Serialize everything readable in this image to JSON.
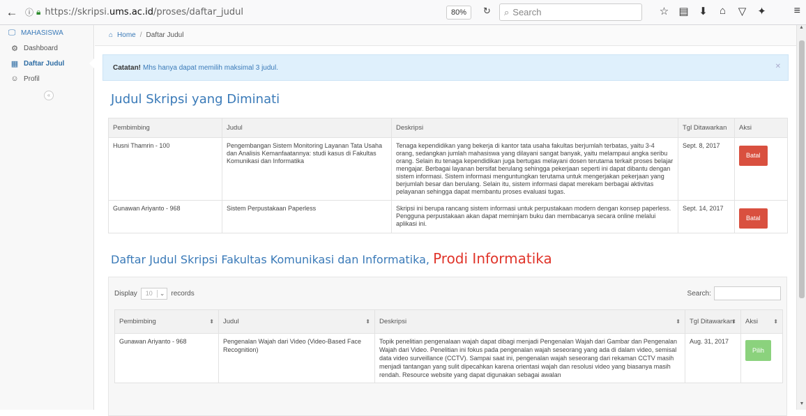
{
  "browser": {
    "url_prefix": "https://skripsi.",
    "url_domain": "ums.ac.id",
    "url_path": "/proses/daftar_judul",
    "zoom": "80%",
    "search_placeholder": "Search"
  },
  "sidebar": {
    "header": "MAHASISWA",
    "items": [
      {
        "label": "Dashboard"
      },
      {
        "label": "Daftar Judul"
      },
      {
        "label": "Profil"
      }
    ]
  },
  "breadcrumb": {
    "home": "Home",
    "sep": "/",
    "current": "Daftar Judul"
  },
  "alert": {
    "bold": "Catatan!",
    "text": "Mhs hanya dapat memilih maksimal 3 judul."
  },
  "section1": {
    "title": "Judul Skripsi yang Diminati",
    "headers": [
      "Pembimbing",
      "Judul",
      "Deskripsi",
      "Tgl Ditawarkan",
      "Aksi"
    ],
    "rows": [
      {
        "pembimbing": "Husni Thamrin - 100",
        "judul": "Pengembangan Sistem Monitoring Layanan Tata Usaha dan Analisis Kemanfaatannya: studi kasus di Fakultas Komunikasi dan Informatika",
        "deskripsi": "Tenaga kependidikan yang bekerja di kantor tata usaha fakultas berjumlah terbatas, yaitu 3-4 orang, sedangkan jumlah mahasiswa yang dilayani sangat banyak, yaitu melampaui angka seribu orang. Selain itu tenaga kependidikan juga bertugas melayani dosen terutama terkait proses belajar mengajar. Berbagai layanan bersifat berulang sehingga pekerjaan seperti ini dapat dibantu dengan sistem informasi. Sistem informasi menguntungkan terutama untuk mengerjakan pekerjaan yang berjumlah besar dan berulang. Selain itu, sistem informasi dapat merekam berbagai aktivitas pelayanan sehingga dapat membantu proses evaluasi tugas.",
        "tgl": "Sept. 8, 2017",
        "aksi": "Batal"
      },
      {
        "pembimbing": "Gunawan Ariyanto - 968",
        "judul": "Sistem Perpustakaan Paperless",
        "deskripsi": "Skripsi ini berupa rancang sistem informasi untuk perpustakaan modern dengan konsep paperless. Pengguna perpustakaan akan dapat meminjam buku dan membacanya secara online melalui aplikasi ini.",
        "tgl": "Sept. 14, 2017",
        "aksi": "Batal"
      }
    ]
  },
  "section2": {
    "title": "Daftar Judul Skripsi Fakultas Komunikasi dan Informatika,",
    "prodi": "Prodi Informatika",
    "display_label": "Display",
    "display_value": "10",
    "records_label": "records",
    "search_label": "Search:",
    "headers": [
      "Pembimbing",
      "Judul",
      "Deskripsi",
      "Tgl Ditawarkan",
      "Aksi"
    ],
    "rows": [
      {
        "pembimbing": "Gunawan Ariyanto - 968",
        "judul": "Pengenalan Wajah dari Video (Video-Based Face Recognition)",
        "deskripsi": "Topik penelitian pengenalaan wajah dapat dibagi menjadi Pengenalan Wajah dari Gambar dan Pengenalan Wajah dari Video. Penelitian ini fokus pada pengenalan wajah seseorang yang ada di dalam video, semisal data video surveillance (CCTV). Sampai saat ini, pengenalan wajah seseorang dari rekaman CCTV masih menjadi tantangan yang sulit dipecahkan karena orientasi wajah dan resolusi video yang biasanya masih rendah. Resource website yang dapat digunakan sebagai awalan",
        "tgl": "Aug. 31, 2017",
        "aksi": "Pilih"
      }
    ]
  }
}
